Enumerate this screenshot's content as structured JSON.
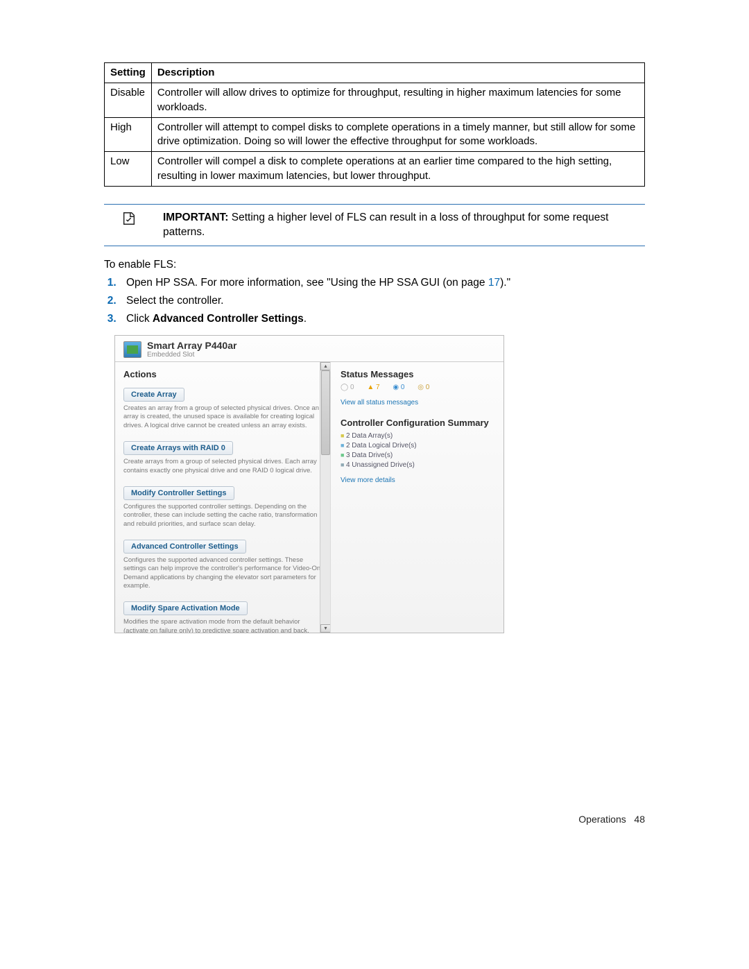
{
  "table": {
    "headers": [
      "Setting",
      "Description"
    ],
    "rows": [
      {
        "setting": "Disable",
        "desc": "Controller will allow drives to optimize for throughput, resulting in higher maximum latencies for some workloads."
      },
      {
        "setting": "High",
        "desc": "Controller will attempt to compel disks to complete operations in a timely manner, but still allow for some drive optimization.   Doing so will lower the effective throughput for some workloads."
      },
      {
        "setting": "Low",
        "desc": "Controller will compel a disk to complete operations at an earlier time compared to the high setting, resulting in lower maximum latencies, but lower throughput."
      }
    ]
  },
  "important": {
    "label": "IMPORTANT:",
    "text": "Setting a higher level of FLS can result in a loss of throughput for some request patterns."
  },
  "intro": "To enable FLS:",
  "steps": {
    "s1_pre": "Open HP SSA. For more information, see \"Using the HP SSA GUI (on page ",
    "s1_link": "17",
    "s1_post": ").\"",
    "s2": "Select the controller.",
    "s3_pre": "Click ",
    "s3_bold": "Advanced Controller Settings",
    "s3_post": "."
  },
  "screenshot": {
    "title": "Smart Array P440ar",
    "subtitle": "Embedded Slot",
    "actions_header": "Actions",
    "status_header": "Status Messages",
    "status_counts": {
      "grey": "0",
      "warn": "7",
      "blue": "0",
      "gold": "0"
    },
    "view_status": "View all status messages",
    "config_header": "Controller Configuration Summary",
    "summary": [
      "2 Data Array(s)",
      "2 Data Logical Drive(s)",
      "3 Data Drive(s)",
      "4 Unassigned Drive(s)"
    ],
    "more_details": "View more details",
    "actions": [
      {
        "label": "Create Array",
        "desc": "Creates an array from a group of selected physical drives. Once an array is created, the unused space is available for creating logical drives. A logical drive cannot be created unless an array exists."
      },
      {
        "label": "Create Arrays with RAID 0",
        "desc": "Create arrays from a group of selected physical drives. Each array contains exactly one physical drive and one RAID 0 logical drive."
      },
      {
        "label": "Modify Controller Settings",
        "desc": "Configures the supported controller settings. Depending on the controller, these can include setting the cache ratio, transformation and rebuild priorities, and surface scan delay."
      },
      {
        "label": "Advanced Controller Settings",
        "desc": "Configures the supported advanced controller settings. These settings can help improve the controller's performance for Video-On-Demand applications by changing the elevator sort parameters for example."
      },
      {
        "label": "Modify Spare Activation Mode",
        "desc": "Modifies the spare activation mode from the default behavior (activate on failure only) to predictive spare activation and back."
      }
    ]
  },
  "footer": {
    "section": "Operations",
    "page": "48"
  }
}
